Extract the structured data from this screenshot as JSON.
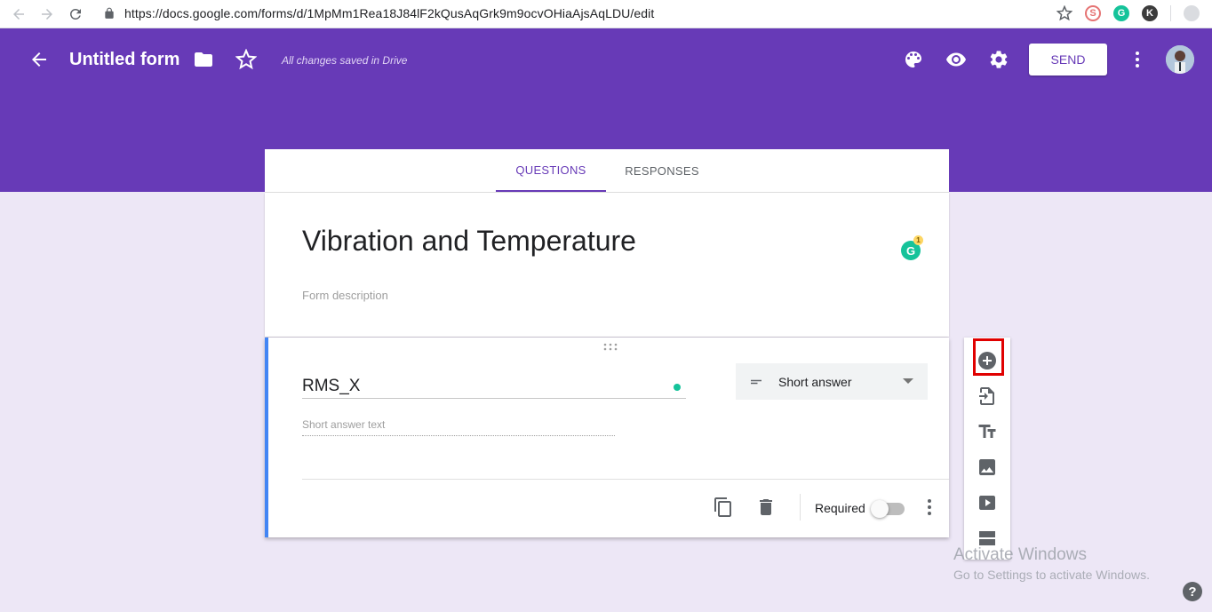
{
  "browser": {
    "url": "https://docs.google.com/forms/d/1MpMm1Rea18J84lF2kQusAqGrk9m9ocvOHiaAjsAqLDU/edit",
    "extensions": [
      "ext-red-icon",
      "grammarly-icon",
      "k-extension-icon",
      "profile-icon"
    ],
    "ext_k_label": "K"
  },
  "header": {
    "title": "Untitled form",
    "saved_status": "All changes saved in Drive",
    "send_label": "SEND",
    "accent_color": "#673ab7"
  },
  "tabs": [
    {
      "label": "QUESTIONS",
      "active": true
    },
    {
      "label": "RESPONSES",
      "active": false
    }
  ],
  "form": {
    "title": "Vibration and Temperature",
    "description_placeholder": "Form description"
  },
  "question": {
    "title": "RMS_X",
    "type": "Short answer",
    "answer_placeholder": "Short answer text",
    "required_label": "Required",
    "required": false
  },
  "side_toolbar": [
    "add-question-icon",
    "import-questions-icon",
    "add-title-icon",
    "add-image-icon",
    "add-video-icon",
    "add-section-icon"
  ],
  "watermark": {
    "line1": "Activate Windows",
    "line2": "Go to Settings to activate Windows."
  },
  "help_label": "?"
}
